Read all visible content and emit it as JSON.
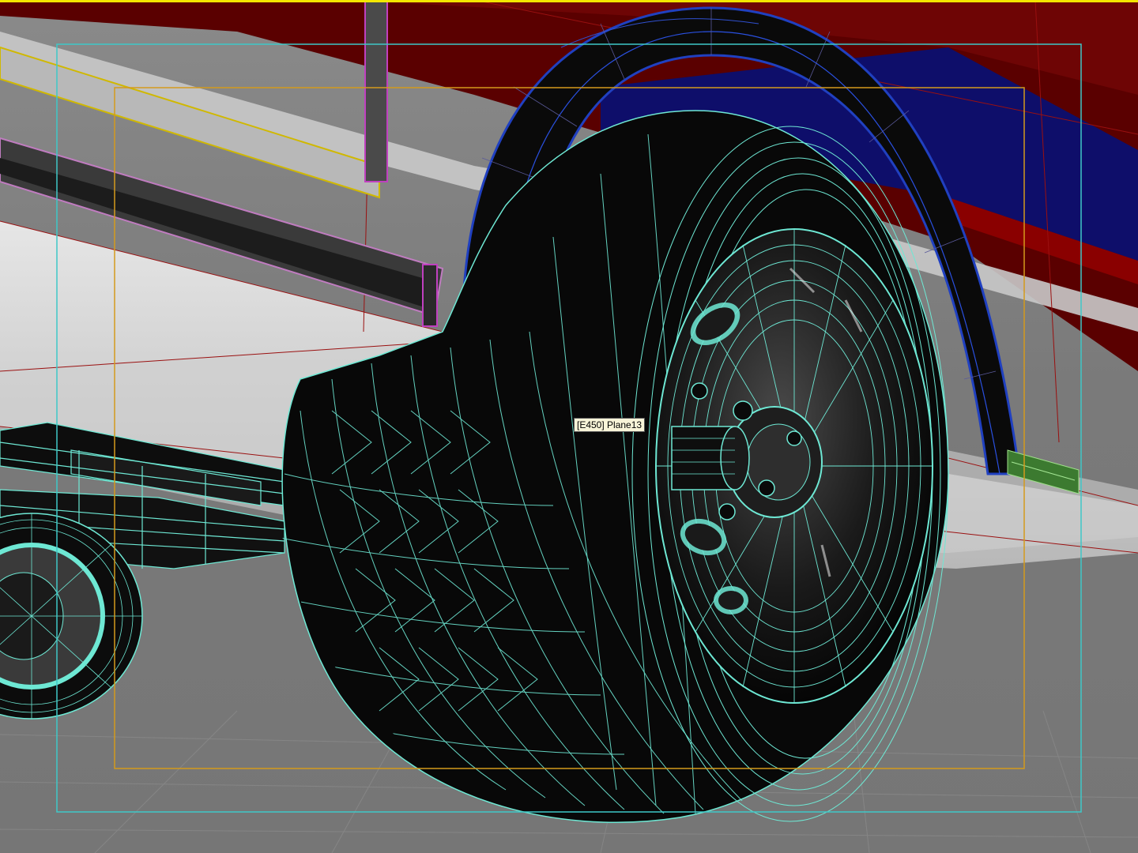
{
  "viewport": {
    "active_border_color": "#f3e600",
    "safe_frame_color": "#3ec8c8",
    "action_safe_color": "#d49a1c",
    "background_color": "#7c7c7c"
  },
  "selection": {
    "tooltip_text": "[E450] Plane13",
    "wireframe_color": "#6ee8d4"
  },
  "scene": {
    "objects": [
      "body-panel",
      "wheel-arch",
      "tire",
      "wheel-rim",
      "wheel-hub",
      "leaf-spring",
      "rear-wheel",
      "mud-flap",
      "ground-grid"
    ],
    "colors": {
      "body_red": "#5a0000",
      "arch_blue": "#10106e",
      "tire_black": "#0a0a0a",
      "panel_white": "#d8d8d8",
      "flap_green": "#3c7a30"
    }
  }
}
